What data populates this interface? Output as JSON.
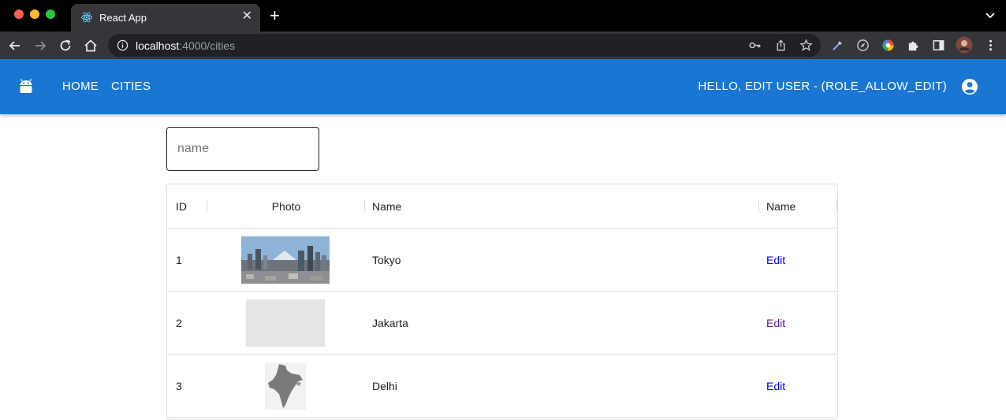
{
  "browser": {
    "tab_title": "React App",
    "new_tab_symbol": "+",
    "close_symbol": "✕",
    "url_host": "localhost",
    "url_rest": ":4000/cities"
  },
  "appbar": {
    "nav": [
      "HOME",
      "CITIES"
    ],
    "greeting": "HELLO, EDIT USER - (ROLE_ALLOW_EDIT)",
    "color": "#1976d2"
  },
  "search": {
    "placeholder": "name",
    "value": ""
  },
  "table": {
    "columns": [
      "ID",
      "Photo",
      "Name",
      "Name"
    ],
    "rows": [
      {
        "id": "1",
        "name": "Tokyo",
        "action": "Edit",
        "photo": "city-skyline-photo"
      },
      {
        "id": "2",
        "name": "Jakarta",
        "action": "Edit",
        "photo": "blank-photo-placeholder"
      },
      {
        "id": "3",
        "name": "Delhi",
        "action": "Edit",
        "photo": "india-map-image"
      }
    ]
  }
}
